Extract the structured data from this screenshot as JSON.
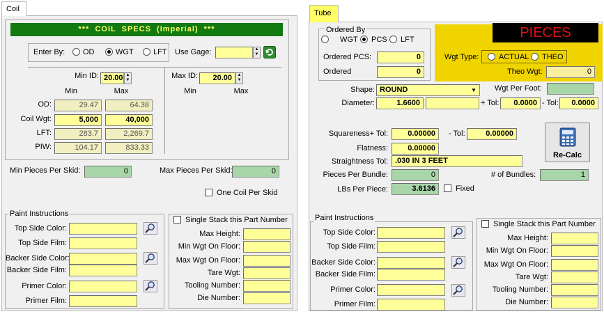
{
  "coil": {
    "tab_label": "Coil",
    "banner": "***  COIL  SPECS  (Imperial)  ***",
    "enter_by": {
      "label": "Enter By:",
      "options": [
        "OD",
        "WGT",
        "LFT"
      ],
      "selected": "WGT"
    },
    "use_gage": {
      "label": "Use Gage:",
      "value": ""
    },
    "min_id": {
      "label": "Min ID:",
      "value": "20.00"
    },
    "max_id": {
      "label": "Max ID:",
      "value": "20.00"
    },
    "col_min": "Min",
    "col_max": "Max",
    "col_min_right": "Min",
    "col_max_right": "Max",
    "rows": [
      {
        "label": "OD:",
        "min": "29.47",
        "max": "64.38"
      },
      {
        "label": "Coil Wgt:",
        "min": "5,000",
        "max": "40,000"
      },
      {
        "label": "LFT:",
        "min": "283.7",
        "max": "2,269.7"
      },
      {
        "label": "PIW:",
        "min": "104.17",
        "max": "833.33"
      }
    ],
    "min_pieces": {
      "label": "Min Pieces Per Skid:",
      "value": "0"
    },
    "max_pieces": {
      "label": "Max Pieces Per Skid:",
      "value": "0"
    },
    "one_coil": "One Coil Per Skid",
    "paint": {
      "title": "Paint Instructions",
      "fields": [
        "Top Side Color:",
        "Top Side Film:",
        "Backer Side Color:",
        "Backer Side Film:",
        "Primer Color:",
        "Primer Film:"
      ]
    },
    "stack": {
      "title": "Single Stack this Part Number",
      "fields": [
        "Max Height:",
        "Min Wgt On Floor:",
        "Max Wgt On Floor:",
        "Tare Wgt:",
        "Tooling Number:",
        "Die Number:"
      ]
    }
  },
  "tube": {
    "tab_label": "Tube",
    "ordered_by": {
      "title": "Ordered By",
      "options": [
        "WGT",
        "PCS",
        "LFT"
      ],
      "selected": "PCS"
    },
    "ordered_pcs": {
      "label": "Ordered PCS:",
      "value": "0"
    },
    "ordered": {
      "label": "Ordered",
      "value": "0"
    },
    "pieces_banner": "PIECES",
    "wgt_type": {
      "label": "Wgt Type:",
      "options": [
        "ACTUAL",
        "THEO"
      ]
    },
    "theo_wgt": {
      "label": "Theo Wgt:",
      "value": "0"
    },
    "shape": {
      "label": "Shape:",
      "value": "ROUND"
    },
    "wgt_per_foot": {
      "label": "Wgt Per Foot:",
      "value": ""
    },
    "diameter": {
      "label": "Diameter:",
      "value": "1.6600",
      "value2": ""
    },
    "plus_tol": {
      "label": "+ Tol:",
      "value": "0.0000"
    },
    "minus_tol": {
      "label": "- Tol:",
      "value": "0.0000"
    },
    "squareness": {
      "label": "Squareness+ Tol:",
      "value": "0.00000"
    },
    "squareness_minus": {
      "label": "- Tol:",
      "value": "0.00000"
    },
    "flatness": {
      "label": "Flatness:",
      "value": "0.00000"
    },
    "straightness": {
      "label": "Straightness Tol:",
      "value": ".030 IN 3 FEET"
    },
    "pieces_per_bundle": {
      "label": "Pieces Per Bundle:",
      "value": "0"
    },
    "num_bundles": {
      "label": "# of Bundles:",
      "value": "1"
    },
    "lbs_per_piece": {
      "label": "LBs Per Piece:",
      "value": "3.6136"
    },
    "fixed": "Fixed",
    "recalc": "Re-Calc",
    "paint": {
      "title": "Paint Instructions",
      "fields": [
        "Top Side Color:",
        "Top Side Film:",
        "Backer Side Color:",
        "Backer Side Film:",
        "Primer Color:",
        "Primer Film:"
      ]
    },
    "stack": {
      "title": "Single Stack this Part Number",
      "fields": [
        "Max Height:",
        "Min Wgt On Floor:",
        "Max Wgt On Floor:",
        "Tare Wgt:",
        "Tooling Number:",
        "Die Number:"
      ]
    }
  },
  "colors": {
    "field": "#ffff99",
    "banner_green": "#117a11",
    "banner_text": "#ffff66",
    "pieces_yellow": "#f0d400",
    "pieces_red": "#e01010",
    "green_field": "#a9d6a9"
  }
}
